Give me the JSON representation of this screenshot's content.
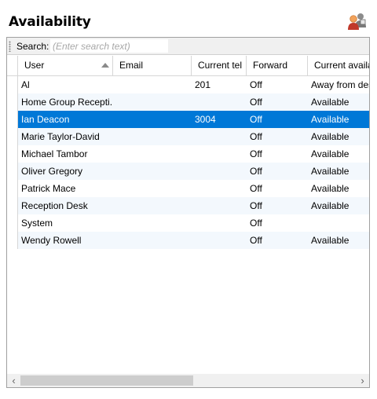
{
  "title": "Availability",
  "search": {
    "label": "Search:",
    "placeholder": "(Enter search text)"
  },
  "columns": [
    "User",
    "Email",
    "Current tel",
    "Forward",
    "Current availab"
  ],
  "rows": [
    {
      "user": "Al",
      "email": "",
      "tel": "201",
      "forward": "Off",
      "availability": "Away from desk"
    },
    {
      "user": "Home Group Recepti...",
      "email": "",
      "tel": "",
      "forward": "Off",
      "availability": "Available"
    },
    {
      "user": "Ian Deacon",
      "email": "",
      "tel": "3004",
      "forward": "Off",
      "availability": "Available"
    },
    {
      "user": "Marie Taylor-David",
      "email": "",
      "tel": "",
      "forward": "Off",
      "availability": "Available"
    },
    {
      "user": "Michael Tambor",
      "email": "",
      "tel": "",
      "forward": "Off",
      "availability": "Available"
    },
    {
      "user": "Oliver Gregory",
      "email": "",
      "tel": "",
      "forward": "Off",
      "availability": "Available"
    },
    {
      "user": "Patrick Mace",
      "email": "",
      "tel": "",
      "forward": "Off",
      "availability": "Available"
    },
    {
      "user": "Reception Desk",
      "email": "",
      "tel": "",
      "forward": "Off",
      "availability": "Available"
    },
    {
      "user": "System",
      "email": "",
      "tel": "",
      "forward": "Off",
      "availability": ""
    },
    {
      "user": "Wendy Rowell",
      "email": "",
      "tel": "",
      "forward": "Off",
      "availability": "Available"
    }
  ],
  "selected_row": 2,
  "sort": {
    "column": "User",
    "direction": "ascending"
  },
  "icons": {
    "users": "users-icon",
    "sort": "sort-ascending-icon",
    "scroll_left": "chevron-left-icon",
    "scroll_right": "chevron-right-icon"
  },
  "colors": {
    "selection": "#0078d7",
    "alt_row": "#f3f8fd"
  }
}
